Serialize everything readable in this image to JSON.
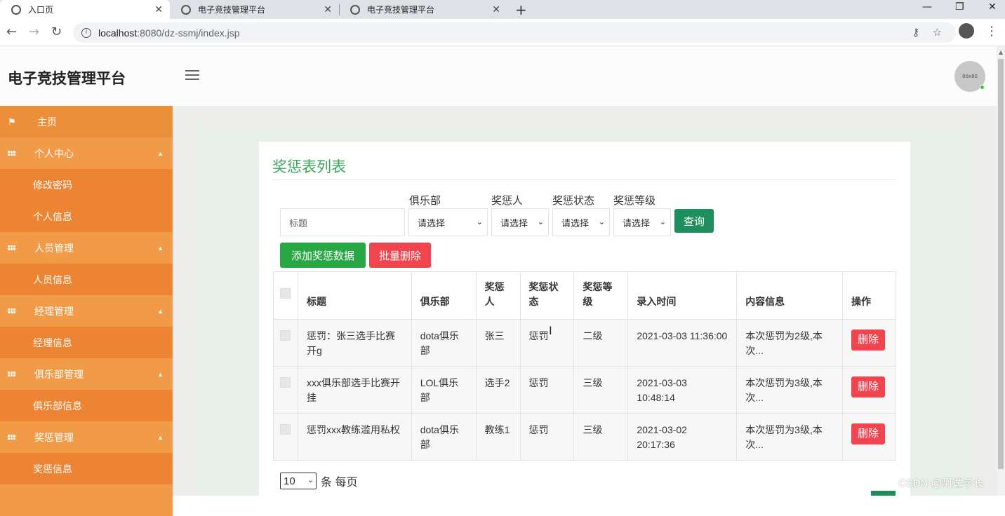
{
  "browser": {
    "tabs": [
      {
        "title": "入口页"
      },
      {
        "title": "电子竞技管理平台"
      },
      {
        "title": "电子竞技管理平台"
      }
    ],
    "url_host": "localhost",
    "url_path": ":8080/dz-ssmj/index.jsp"
  },
  "header": {
    "brand": "电子竞技管理平台",
    "avatar_text": "80x80"
  },
  "sidebar": {
    "items": [
      {
        "label": "主页",
        "type": "home"
      },
      {
        "label": "个人中心",
        "type": "group"
      },
      {
        "label": "修改密码",
        "type": "sub"
      },
      {
        "label": "个人信息",
        "type": "sub"
      },
      {
        "label": "人员管理",
        "type": "group"
      },
      {
        "label": "人员信息",
        "type": "sub"
      },
      {
        "label": "经理管理",
        "type": "group"
      },
      {
        "label": "经理信息",
        "type": "sub"
      },
      {
        "label": "俱乐部管理",
        "type": "group"
      },
      {
        "label": "俱乐部信息",
        "type": "sub"
      },
      {
        "label": "奖惩管理",
        "type": "group"
      },
      {
        "label": "奖惩信息",
        "type": "sub"
      }
    ]
  },
  "main": {
    "title": "奖惩表列表",
    "filters": {
      "title_placeholder": "标题",
      "club_label": "俱乐部",
      "person_label": "奖惩人",
      "status_label": "奖惩状态",
      "level_label": "奖惩等级",
      "select_default": "请选择",
      "query_button": "查询"
    },
    "actions": {
      "add_button": "添加奖惩数据",
      "batch_delete_button": "批量删除"
    },
    "table": {
      "headers": [
        "标题",
        "俱乐部",
        "奖惩人",
        "奖惩状态",
        "奖惩等级",
        "录入时间",
        "内容信息",
        "操作"
      ],
      "rows": [
        {
          "title": "惩罚：张三选手比赛开g",
          "club": "dota俱乐部",
          "person": "张三",
          "status": "惩罚",
          "level": "二级",
          "time": "2021-03-03 11:36:00",
          "content": "本次惩罚为2级,本次...",
          "action": "删除"
        },
        {
          "title": "xxx俱乐部选手比赛开挂",
          "club": "LOL俱乐部",
          "person": "选手2",
          "status": "惩罚",
          "level": "三级",
          "time": "2021-03-03 10:48:14",
          "content": "本次惩罚为3级,本次...",
          "action": "删除"
        },
        {
          "title": "惩罚xxx教练滥用私权",
          "club": "dota俱乐部",
          "person": "教练1",
          "status": "惩罚",
          "level": "三级",
          "time": "2021-03-02 20:17:36",
          "content": "本次惩罚为3级,本次...",
          "action": "删除"
        }
      ]
    },
    "pager": {
      "page_size": "10",
      "suffix": "条 每页"
    }
  },
  "watermark": "CSDN @阿逸学长",
  "colors": {
    "sidebar": "#ec8f3a",
    "title_green": "#3da35d",
    "query_green": "#1e8f5c",
    "add_green": "#28a745",
    "delete_red": "#f0444f"
  }
}
